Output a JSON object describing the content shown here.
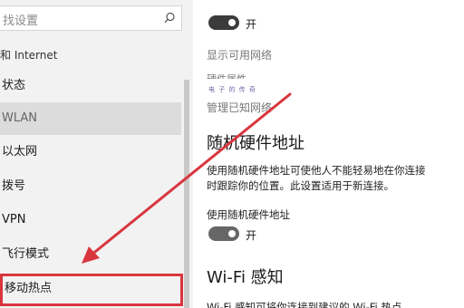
{
  "nav": {
    "search_placeholder": "找设置",
    "header": "和 Internet",
    "items": [
      {
        "label": "状态"
      },
      {
        "label": "WLAN"
      },
      {
        "label": "以太网"
      },
      {
        "label": "拨号"
      },
      {
        "label": "VPN"
      },
      {
        "label": "飞行模式"
      },
      {
        "label": "移动热点"
      }
    ]
  },
  "content": {
    "top_toggle": {
      "state_label": "开"
    },
    "links": [
      "显示可用网络",
      "硬件属性",
      "管理已知网络"
    ],
    "watermark": "电 子 的 传 奇",
    "random_mac": {
      "title": "随机硬件地址",
      "description_line1": "使用随机硬件地址可使他人不能轻易地在你连接",
      "description_line2": "时跟踪你的位置。此设置适用于新连接。",
      "toggle_caption": "使用随机硬件地址",
      "toggle_state": "开"
    },
    "wifi_sense": {
      "title": "Wi-Fi 感知",
      "description_partial": "Wi-Fi 感知可将你连接到建议的 Wi-Fi 热点"
    }
  },
  "colors": {
    "highlight_box": "#d9363e",
    "arrow": "#d9363e",
    "toggle_on": "#3b3b3b"
  },
  "icons": [
    "search-icon"
  ]
}
